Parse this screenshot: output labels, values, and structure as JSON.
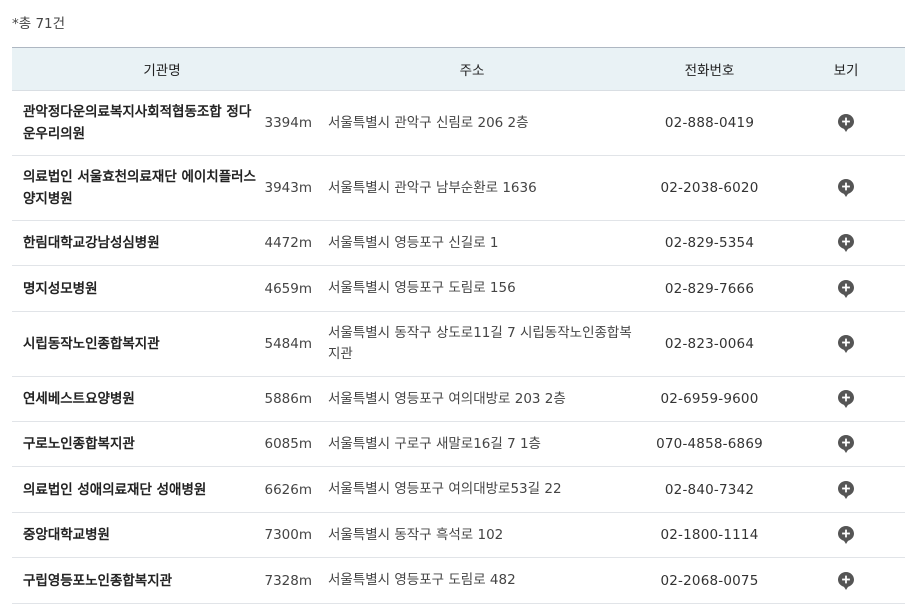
{
  "total_label": "*총 71건",
  "headers": {
    "name": "기관명",
    "address": "주소",
    "phone": "전화번호",
    "view": "보기"
  },
  "icon": "map-pin-icon",
  "rows": [
    {
      "name": "관악정다운의료복지사회적협동조합 정다운우리의원",
      "distance": "3394m",
      "address": "서울특별시 관악구 신림로 206 2층",
      "phone": "02-888-0419"
    },
    {
      "name": "의료법인 서울효천의료재단 에이치플러스 양지병원",
      "distance": "3943m",
      "address": "서울특별시 관악구 남부순환로 1636",
      "phone": "02-2038-6020"
    },
    {
      "name": "한림대학교강남성심병원",
      "distance": "4472m",
      "address": "서울특별시 영등포구 신길로 1",
      "phone": "02-829-5354"
    },
    {
      "name": "명지성모병원",
      "distance": "4659m",
      "address": "서울특별시 영등포구 도림로 156",
      "phone": "02-829-7666"
    },
    {
      "name": "시립동작노인종합복지관",
      "distance": "5484m",
      "address": "서울특별시 동작구 상도로11길 7 시립동작노인종합복지관",
      "phone": "02-823-0064"
    },
    {
      "name": "연세베스트요양병원",
      "distance": "5886m",
      "address": "서울특별시 영등포구 여의대방로 203 2층",
      "phone": "02-6959-9600"
    },
    {
      "name": "구로노인종합복지관",
      "distance": "6085m",
      "address": "서울특별시 구로구 새말로16길 7 1층",
      "phone": "070-4858-6869"
    },
    {
      "name": "의료법인 성애의료재단 성애병원",
      "distance": "6626m",
      "address": "서울특별시 영등포구 여의대방로53길 22",
      "phone": "02-840-7342"
    },
    {
      "name": "중앙대학교병원",
      "distance": "7300m",
      "address": "서울특별시 동작구 흑석로 102",
      "phone": "02-1800-1114"
    },
    {
      "name": "구립영등포노인종합복지관",
      "distance": "7328m",
      "address": "서울특별시 영등포구 도림로 482",
      "phone": "02-2068-0075"
    }
  ]
}
